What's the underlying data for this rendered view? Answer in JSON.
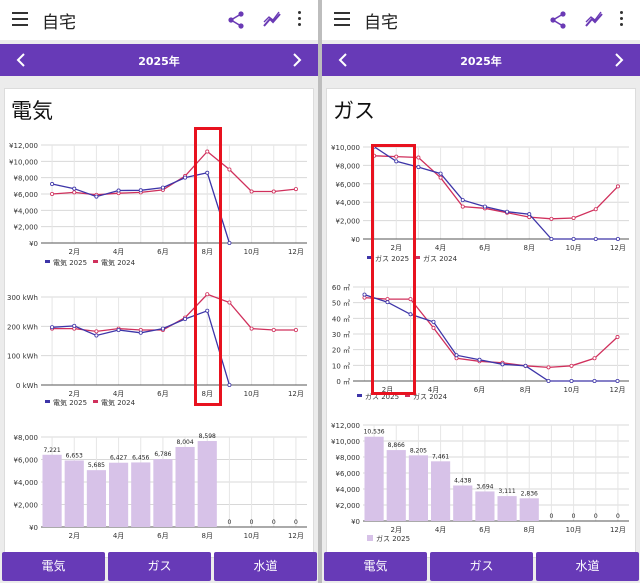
{
  "screens": [
    {
      "app_title": "自宅",
      "year": "2025年",
      "section_title": "電気",
      "tabs": [
        "電気",
        "ガス",
        "水道"
      ],
      "colors": {
        "series_current": "#3d35a8",
        "series_previous": "#d0305c",
        "bars": "#d7c2e8",
        "accent": "#673ab7"
      }
    },
    {
      "app_title": "自宅",
      "year": "2025年",
      "section_title": "ガス",
      "tabs": [
        "電気",
        "ガス",
        "水道"
      ],
      "colors": {
        "series_current": "#3d35a8",
        "series_previous": "#d0305c",
        "bars": "#d7c2e8",
        "accent": "#673ab7"
      }
    }
  ],
  "icons": [
    "menu-icon",
    "share-icon",
    "trend-icon",
    "more-vert-icon",
    "chevron-left-icon",
    "chevron-right-icon"
  ],
  "chart_data": [
    {
      "id": "electric-cost",
      "type": "line",
      "x": [
        1,
        2,
        3,
        4,
        5,
        6,
        7,
        8,
        9,
        10,
        11,
        12
      ],
      "x_tick_labels": [
        "2月",
        "4月",
        "6月",
        "8月",
        "10月",
        "12月"
      ],
      "y_tick_labels": [
        "¥0",
        "¥2,000",
        "¥4,000",
        "¥6,000",
        "¥8,000",
        "¥10,000",
        "¥12,000"
      ],
      "ylim": [
        0,
        12000
      ],
      "series": [
        {
          "name": "電気 2025",
          "values": [
            7221,
            6653,
            5685,
            6427,
            6456,
            6786,
            8004,
            8598,
            0,
            null,
            null,
            null
          ]
        },
        {
          "name": "電気 2024",
          "values": [
            6000,
            6200,
            5900,
            6100,
            6200,
            6500,
            8200,
            11200,
            9000,
            6300,
            6300,
            6600
          ]
        }
      ],
      "legend": "bottom"
    },
    {
      "id": "electric-kwh",
      "type": "line",
      "x": [
        1,
        2,
        3,
        4,
        5,
        6,
        7,
        8,
        9,
        10,
        11,
        12
      ],
      "x_tick_labels": [
        "2月",
        "4月",
        "6月",
        "8月",
        "10月",
        "12月"
      ],
      "y_tick_labels": [
        "0 kWh",
        "100 kWh",
        "200 kWh",
        "300 kWh"
      ],
      "ylim": [
        0,
        320
      ],
      "series": [
        {
          "name": "電気 2025",
          "values": [
            210,
            215,
            180,
            200,
            190,
            205,
            240,
            270,
            0,
            null,
            null,
            null
          ]
        },
        {
          "name": "電気 2024",
          "values": [
            205,
            205,
            195,
            205,
            200,
            200,
            245,
            330,
            300,
            205,
            200,
            200
          ]
        }
      ],
      "legend": "bottom"
    },
    {
      "id": "electric-bars",
      "type": "bar",
      "categories": [
        1,
        2,
        3,
        4,
        5,
        6,
        7,
        8,
        9,
        10,
        11,
        12
      ],
      "x_tick_labels": [
        "2月",
        "4月",
        "6月",
        "8月",
        "10月",
        "12月"
      ],
      "y_tick_labels": [
        "¥0",
        "¥2,000",
        "¥4,000",
        "¥6,000",
        "¥8,000"
      ],
      "ylim": [
        0,
        9000
      ],
      "values": [
        7221,
        6653,
        5685,
        6427,
        6456,
        6786,
        8004,
        8598,
        0,
        0,
        0,
        0
      ],
      "value_labels": [
        "7,221",
        "6,653",
        "5,685",
        "6,427",
        "6,456",
        "6,786",
        "8,004",
        "8,598",
        "0",
        "0",
        "0",
        "0"
      ]
    },
    {
      "id": "gas-cost",
      "type": "line",
      "x": [
        1,
        2,
        3,
        4,
        5,
        6,
        7,
        8,
        9,
        10,
        11,
        12
      ],
      "x_tick_labels": [
        "2月",
        "4月",
        "6月",
        "8月",
        "10月",
        "12月"
      ],
      "y_tick_labels": [
        "¥0",
        "¥2,000",
        "¥4,000",
        "¥6,000",
        "¥8,000",
        "¥10,000"
      ],
      "ylim": [
        0,
        10500
      ],
      "series": [
        {
          "name": "ガス 2025",
          "values": [
            10536,
            8866,
            8205,
            7461,
            4438,
            3694,
            3111,
            2836,
            0,
            0,
            0,
            0
          ]
        },
        {
          "name": "ガス 2024",
          "values": [
            9500,
            9400,
            9300,
            7000,
            3700,
            3500,
            3000,
            2500,
            2300,
            2400,
            3400,
            6000
          ]
        }
      ],
      "legend": "bottom"
    },
    {
      "id": "gas-m3",
      "type": "line",
      "x": [
        1,
        2,
        3,
        4,
        5,
        6,
        7,
        8,
        9,
        10,
        11,
        12
      ],
      "x_tick_labels": [
        "2月",
        "4月",
        "6月",
        "8月",
        "10月",
        "12月"
      ],
      "y_tick_labels": [
        "0 ㎥",
        "10 ㎥",
        "20 ㎥",
        "30 ㎥",
        "40 ㎥",
        "50 ㎥",
        "60 ㎥"
      ],
      "ylim": [
        0,
        62
      ],
      "series": [
        {
          "name": "ガス 2025",
          "values": [
            57,
            52,
            44,
            39,
            17,
            14,
            11,
            10,
            0,
            0,
            0,
            0
          ]
        },
        {
          "name": "ガス 2024",
          "values": [
            55,
            54,
            54,
            35,
            15,
            13,
            12,
            10,
            9,
            10,
            15,
            29
          ]
        }
      ],
      "legend": "bottom"
    },
    {
      "id": "gas-bars",
      "type": "bar",
      "categories": [
        1,
        2,
        3,
        4,
        5,
        6,
        7,
        8,
        9,
        10,
        11,
        12
      ],
      "x_tick_labels": [
        "2月",
        "4月",
        "6月",
        "8月",
        "10月",
        "12月"
      ],
      "y_tick_labels": [
        "¥0",
        "¥2,000",
        "¥4,000",
        "¥6,000",
        "¥8,000",
        "¥10,000",
        "¥12,000"
      ],
      "ylim": [
        0,
        12000
      ],
      "values": [
        10536,
        8866,
        8205,
        7461,
        4438,
        3694,
        3111,
        2836,
        0,
        0,
        0,
        0
      ],
      "value_labels": [
        "10,536",
        "8,866",
        "8,205",
        "7,461",
        "4,438",
        "3,694",
        "3,111",
        "2,836",
        "0",
        "0",
        "0",
        "0"
      ],
      "legend_entry": "ガス 2025"
    }
  ]
}
